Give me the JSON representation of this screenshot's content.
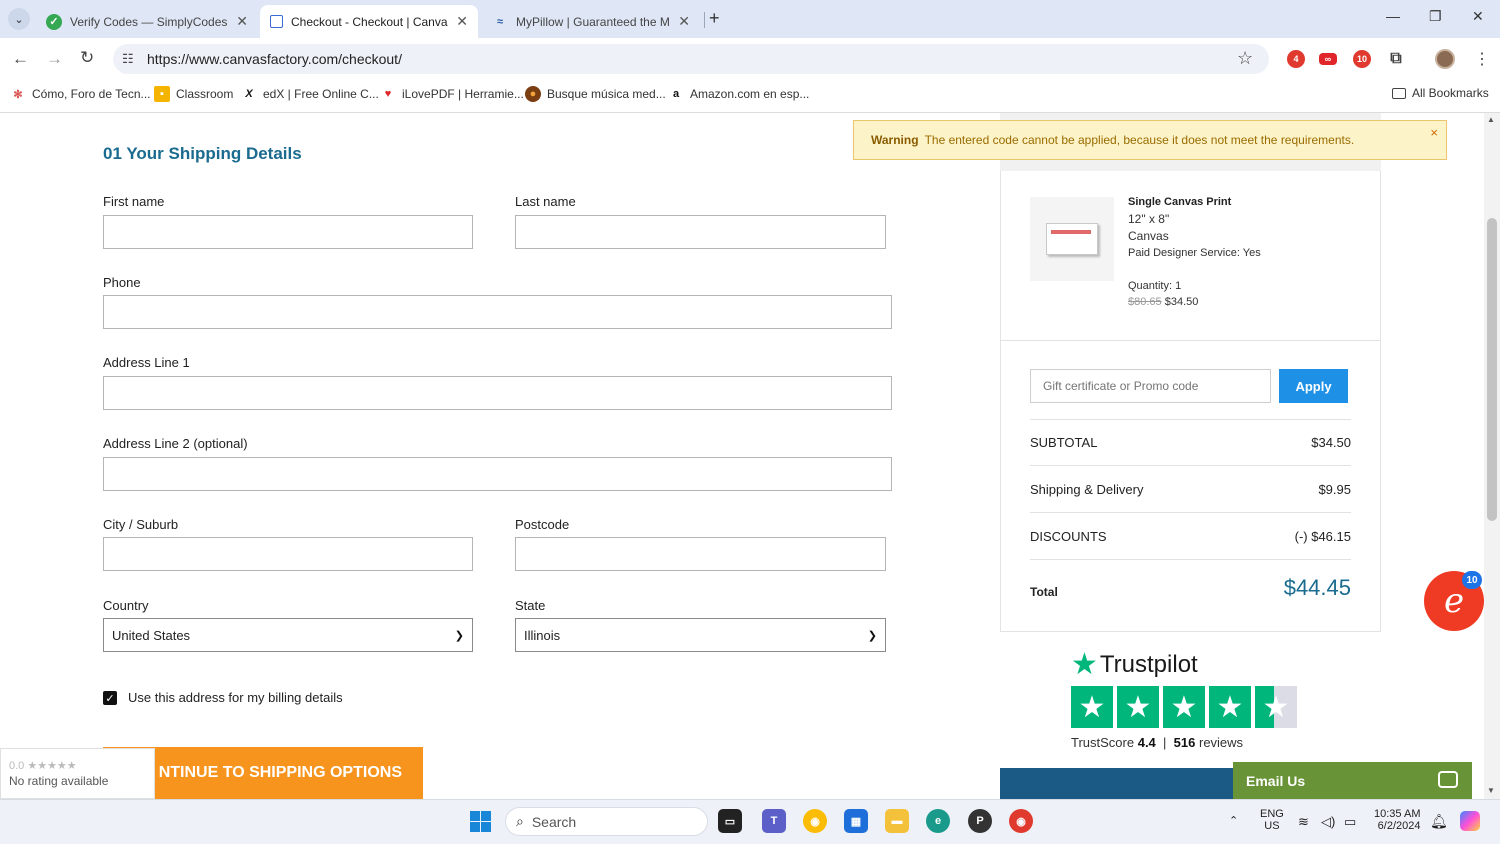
{
  "browser": {
    "tabs": [
      {
        "title": "Verify Codes — SimplyCodes",
        "active": false
      },
      {
        "title": "Checkout - Checkout | Canvas F",
        "active": true
      },
      {
        "title": "MyPillow | Guaranteed the Mos",
        "active": false
      }
    ],
    "url": "https://www.canvasfactory.com/checkout/",
    "extension_badges": [
      "4",
      "10"
    ],
    "bookmarks": [
      "Cómo, Foro de Tecn...",
      "Classroom",
      "edX | Free Online C...",
      "iLovePDF | Herramie...",
      "Busque música med...",
      "Amazon.com en esp..."
    ],
    "all_bookmarks": "All Bookmarks"
  },
  "shipping": {
    "title": "01  Your Shipping Details",
    "first_name_label": "First name",
    "last_name_label": "Last name",
    "phone_label": "Phone",
    "address1_label": "Address Line 1",
    "address2_label": "Address Line 2 (optional)",
    "city_label": "City / Suburb",
    "postcode_label": "Postcode",
    "country_label": "Country",
    "country_value": "United States",
    "state_label": "State",
    "state_value": "Illinois",
    "billing_checkbox_label": "Use this address for my billing details",
    "billing_checked": true,
    "continue_button": "NTINUE TO SHIPPING OPTIONS"
  },
  "rating_badge": {
    "score": "0.0 ★★★★★",
    "text": "No rating available"
  },
  "warning": {
    "label": "Warning",
    "message": "The entered code cannot be applied, because it does not meet the requirements.",
    "close": "×"
  },
  "order": {
    "product_name": "Single Canvas Print",
    "size": "12\" x 8\"",
    "material": "Canvas",
    "designer_service": "Paid Designer Service:  Yes",
    "quantity": "Quantity: 1",
    "original_price": "$80.65",
    "price": "$34.50",
    "promo_placeholder": "Gift certificate or Promo code",
    "apply_button": "Apply",
    "subtotal_label": "SUBTOTAL",
    "subtotal_value": "$34.50",
    "shipping_label": "Shipping & Delivery",
    "shipping_value": "$9.95",
    "discounts_label": "DISCOUNTS",
    "discounts_value": "(-) $46.15",
    "total_label": "Total",
    "total_value": "$44.45"
  },
  "trustpilot": {
    "brand": "Trustpilot",
    "trustscore_label": "TrustScore",
    "score": "4.4",
    "reviews_count": "516",
    "reviews_label": "reviews",
    "stars": 4.4
  },
  "chat": {
    "email_us": "Email Us",
    "badge": "10"
  },
  "taskbar": {
    "search": "Search",
    "lang": "ENG",
    "region": "US",
    "time": "10:35 AM",
    "date": "6/2/2024"
  },
  "colors": {
    "accent_blue": "#1a6b8f",
    "apply_blue": "#1e90e6",
    "continue_orange": "#f7941d",
    "warning_bg": "#fcf3c8",
    "trustpilot_green": "#00b67a",
    "email_green": "#689437"
  }
}
